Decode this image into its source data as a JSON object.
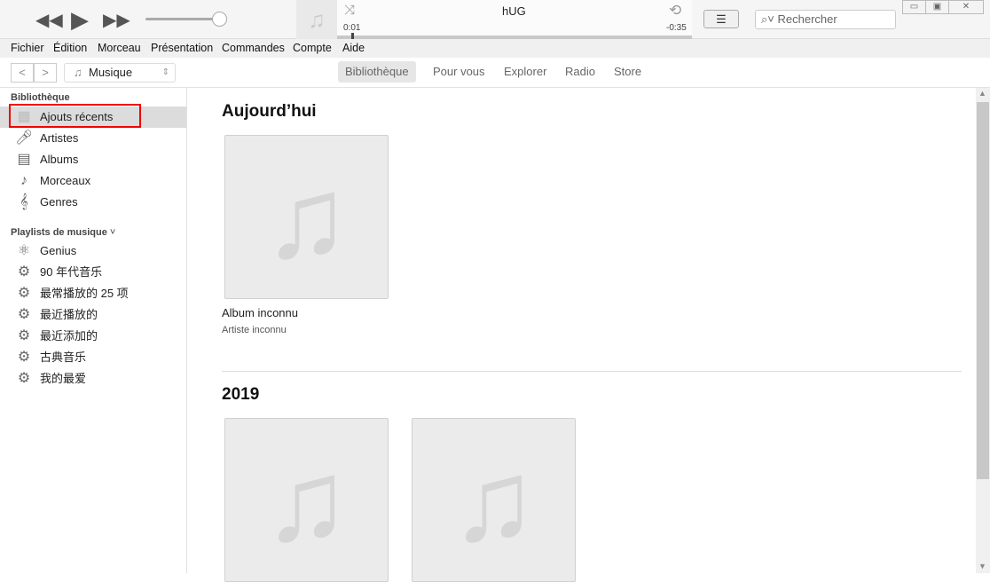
{
  "player": {
    "track_title": "hUG",
    "elapsed": "0:01",
    "remaining": "-0:35",
    "progress_fraction": 0.04,
    "volume_fraction": 0.9
  },
  "search": {
    "placeholder": "Rechercher"
  },
  "menu": [
    "Fichier",
    "Édition",
    "Morceau",
    "Présentation",
    "Commandes",
    "Compte",
    "Aide"
  ],
  "nav": {
    "media_selector": "Musique",
    "tabs": [
      {
        "label": "Bibliothèque",
        "active": true
      },
      {
        "label": "Pour vous"
      },
      {
        "label": "Explorer"
      },
      {
        "label": "Radio"
      },
      {
        "label": "Store"
      }
    ]
  },
  "sidebar": {
    "library_header": "Bibliothèque",
    "library": [
      {
        "label": "Ajouts récents",
        "icon": "grid-icon",
        "selected": true
      },
      {
        "label": "Artistes",
        "icon": "microphone-icon"
      },
      {
        "label": "Albums",
        "icon": "album-icon"
      },
      {
        "label": "Morceaux",
        "icon": "music-note-icon"
      },
      {
        "label": "Genres",
        "icon": "guitar-icon"
      }
    ],
    "playlists_header": "Playlists de musique",
    "playlists": [
      {
        "label": "Genius",
        "icon": "atom-icon"
      },
      {
        "label": "90 年代音乐",
        "icon": "gear-icon"
      },
      {
        "label": "最常播放的 25 项",
        "icon": "gear-icon"
      },
      {
        "label": "最近播放的",
        "icon": "gear-icon"
      },
      {
        "label": "最近添加的",
        "icon": "gear-icon"
      },
      {
        "label": "古典音乐",
        "icon": "gear-icon"
      },
      {
        "label": "我的最爱",
        "icon": "gear-icon"
      }
    ]
  },
  "main": {
    "sections": [
      {
        "title": "Aujourd’hui",
        "albums": [
          {
            "title": "Album inconnu",
            "artist": "Artiste inconnu"
          }
        ]
      },
      {
        "title": "2019",
        "albums": [
          {},
          {}
        ]
      }
    ]
  }
}
